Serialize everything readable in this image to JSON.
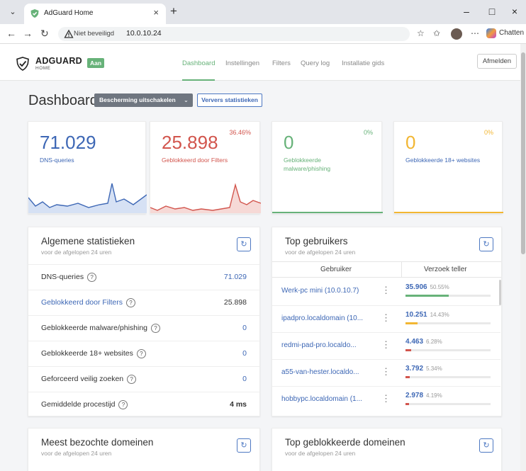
{
  "browser": {
    "tab_title": "AdGuard Home",
    "security_text": "Niet beveiligd",
    "url": "10.0.10.24",
    "copilot_label": "Chatten",
    "icons": [
      "tab-list-icon",
      "shield-icon",
      "close-icon",
      "plus-icon",
      "minimize-icon",
      "maximize-icon",
      "back-icon",
      "forward-icon",
      "reload-icon",
      "warning-icon",
      "star-icon",
      "favorites-icon",
      "more-icon",
      "copilot-icon"
    ]
  },
  "app": {
    "logo": "ADGUARD",
    "logo_sub": "HOME",
    "status_badge": "Aan",
    "nav": [
      "Dashboard",
      "Instellingen",
      "Filters",
      "Query log",
      "Installatie gids"
    ],
    "active_nav": "Dashboard",
    "logout_label": "Afmelden",
    "accent": "#67b279"
  },
  "dashboard": {
    "title": "Dashboard",
    "protect_button": "Bescherming uitschakelen",
    "refresh_stats_button": "Ververs statistieken"
  },
  "cards": [
    {
      "value": "71.029",
      "label": "DNS-queries",
      "percent": "",
      "color": "#3d67b5",
      "fill": "#d6e1f4"
    },
    {
      "value": "25.898",
      "label": "Geblokkeerd door Filters",
      "percent": "36.46%",
      "color": "#d2554d",
      "fill": "#f6d9d6"
    },
    {
      "value": "0",
      "label": "Geblokkeerde malware/phishing",
      "percent": "0%",
      "color": "#67b279",
      "fill": "#dff0e3"
    },
    {
      "value": "0",
      "label": "Geblokkeerde 18+ websites",
      "percent": "0%",
      "color": "#f2b632",
      "fill": "#fdf1d6"
    }
  ],
  "general_stats": {
    "title": "Algemene statistieken",
    "subtitle": "voor de afgelopen 24 uren",
    "rows": [
      {
        "label": "DNS-queries",
        "value": "71.029"
      },
      {
        "label": "Geblokkeerd door Filters",
        "value": "25.898"
      },
      {
        "label": "Geblokkeerde malware/phishing",
        "value": "0"
      },
      {
        "label": "Geblokkeerde 18+ websites",
        "value": "0"
      },
      {
        "label": "Geforceerd veilig zoeken",
        "value": "0"
      },
      {
        "label": "Gemiddelde procestijd",
        "value": "4 ms"
      }
    ]
  },
  "top_clients": {
    "title": "Top gebruikers",
    "subtitle": "voor de afgelopen 24 uren",
    "col_client": "Gebruiker",
    "col_count": "Verzoek teller",
    "rows": [
      {
        "name": "Werk-pc mini (10.0.10.7)",
        "count": "35.906",
        "pct": "50.55%",
        "share": 0.5055,
        "color": "#67b279"
      },
      {
        "name": "ipadpro.localdomain (10...",
        "count": "10.251",
        "pct": "14.43%",
        "share": 0.1443,
        "color": "#f2b632"
      },
      {
        "name": "redmi-pad-pro.localdo...",
        "count": "4.463",
        "pct": "6.28%",
        "share": 0.0628,
        "color": "#d2554d"
      },
      {
        "name": "a55-van-hester.localdo...",
        "count": "3.792",
        "pct": "5.34%",
        "share": 0.0534,
        "color": "#d2554d"
      },
      {
        "name": "hobbypc.localdomain (1...",
        "count": "2.978",
        "pct": "4.19%",
        "share": 0.0419,
        "color": "#d2554d"
      }
    ]
  },
  "top_domains": {
    "title": "Meest bezochte domeinen",
    "subtitle": "voor de afgelopen 24 uren"
  },
  "top_blocked": {
    "title": "Top geblokkeerde domeinen",
    "subtitle": "voor de afgelopen 24 uren"
  }
}
